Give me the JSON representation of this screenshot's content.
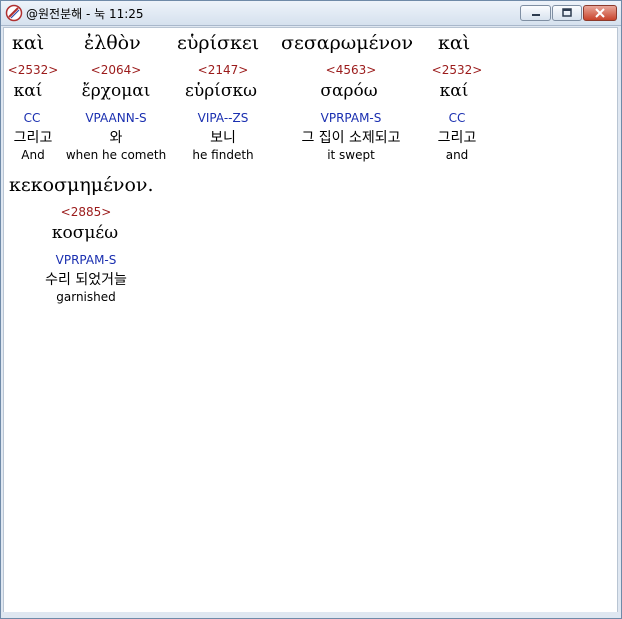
{
  "window": {
    "title": "@원전분해 - 눅 11:25"
  },
  "words": [
    {
      "greek": "καὶ",
      "strong": "<2532>",
      "lemma": "καί",
      "morph": "CC",
      "korean": "그리고",
      "english": "And"
    },
    {
      "greek": "ἐλθὸν",
      "strong": "<2064>",
      "lemma": "ἔρχομαι",
      "morph": "VPAANN-S",
      "korean": "와",
      "english": "when he cometh"
    },
    {
      "greek": "εὑρίσκει",
      "strong": "<2147>",
      "lemma": "εὑρίσκω",
      "morph": "VIPA--ZS",
      "korean": "보니",
      "english": "he findeth"
    },
    {
      "greek": "σεσαρωμένον",
      "strong": "<4563>",
      "lemma": "σαρόω",
      "morph": "VPRPAM-S",
      "korean": "그 집이 소제되고",
      "english": "it swept"
    },
    {
      "greek": "καὶ",
      "strong": "<2532>",
      "lemma": "καί",
      "morph": "CC",
      "korean": "그리고",
      "english": "and"
    },
    {
      "greek": "κεκοσμημένον.",
      "strong": "<2885>",
      "lemma": "κοσμέω",
      "morph": "VPRPAM-S",
      "korean": "수리 되었거늘",
      "english": "garnished"
    }
  ]
}
